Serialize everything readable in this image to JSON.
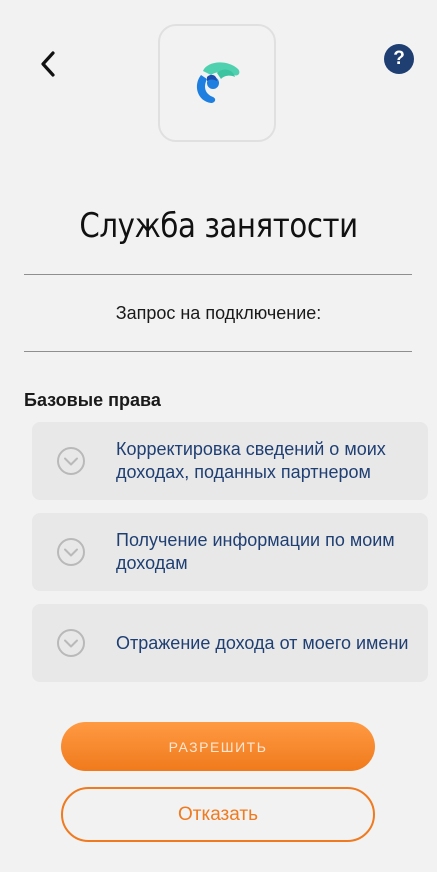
{
  "header": {
    "back_icon": "chevron-left-icon",
    "help_icon": "question-mark-icon",
    "help_label": "?",
    "logo_icon": "app-logo-icon",
    "colors": {
      "help_bg": "#1f3f73",
      "logo_blue": "#1e7fe0",
      "logo_teal": "#4fd1b0"
    }
  },
  "service": {
    "title": "Служба занятости",
    "request_label": "Запрос на подключение:"
  },
  "permissions": {
    "section_title": "Базовые права",
    "items": [
      {
        "label": "Корректировка сведений о моих доходах, поданных партнером",
        "icon": "chevron-down-circle-icon"
      },
      {
        "label": "Получение информации по моим доходам",
        "icon": "chevron-down-circle-icon"
      },
      {
        "label": "Отражение дохода от моего имени",
        "icon": "chevron-down-circle-icon"
      }
    ]
  },
  "actions": {
    "allow_label": "РАЗРЕШИТЬ",
    "deny_label": "Отказать",
    "colors": {
      "accent": "#f07a1c",
      "link_text": "#1f3f73"
    }
  }
}
